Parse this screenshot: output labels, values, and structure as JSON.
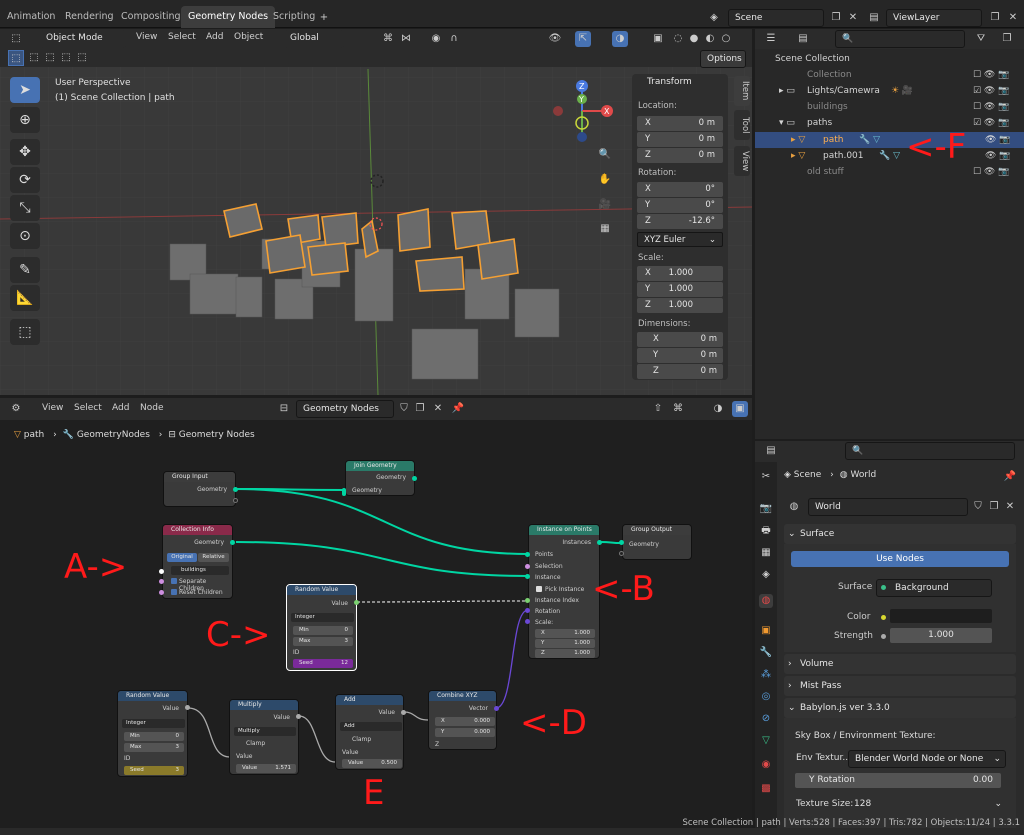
{
  "workspace_tabs": [
    "Animation",
    "Rendering",
    "Compositing",
    "Geometry Nodes",
    "Scripting"
  ],
  "active_tab": "Geometry Nodes",
  "scene_name": "Scene",
  "view_layer": "ViewLayer",
  "viewport": {
    "mode": "Object Mode",
    "menu": [
      "View",
      "Select",
      "Add",
      "Object"
    ],
    "orientation": "Global",
    "options": "Options",
    "perspective": "User Perspective",
    "collection_path": "(1) Scene Collection | path"
  },
  "transform": {
    "title": "Transform",
    "location_label": "Location:",
    "location": [
      {
        "axis": "X",
        "value": "0 m"
      },
      {
        "axis": "Y",
        "value": "0 m"
      },
      {
        "axis": "Z",
        "value": "0 m"
      }
    ],
    "rotation_label": "Rotation:",
    "rotation": [
      {
        "axis": "X",
        "value": "0°"
      },
      {
        "axis": "Y",
        "value": "0°"
      },
      {
        "axis": "Z",
        "value": "-12.6°"
      }
    ],
    "rotation_mode": "XYZ Euler",
    "scale_label": "Scale:",
    "scale": [
      {
        "axis": "X",
        "value": "1.000"
      },
      {
        "axis": "Y",
        "value": "1.000"
      },
      {
        "axis": "Z",
        "value": "1.000"
      }
    ],
    "dimensions_label": "Dimensions:",
    "dimensions": [
      {
        "axis": "X",
        "value": "0 m"
      },
      {
        "axis": "Y",
        "value": "0 m"
      },
      {
        "axis": "Z",
        "value": "0 m"
      }
    ]
  },
  "side_tabs": [
    "Item",
    "Tool",
    "View"
  ],
  "outliner": {
    "rows": [
      {
        "label": "Scene Collection",
        "dim": false,
        "sel": false
      },
      {
        "label": "Collection",
        "dim": true,
        "sel": false
      },
      {
        "label": "Lights/Camewra",
        "dim": false,
        "sel": false
      },
      {
        "label": "buildings",
        "dim": true,
        "sel": false
      },
      {
        "label": "paths",
        "dim": false,
        "sel": false
      },
      {
        "label": "path",
        "dim": false,
        "sel": true
      },
      {
        "label": "path.001",
        "dim": false,
        "sel": false
      },
      {
        "label": "old stuff",
        "dim": true,
        "sel": false
      }
    ]
  },
  "node_editor": {
    "menu": [
      "View",
      "Select",
      "Add",
      "Node"
    ],
    "tree_name": "Geometry Nodes",
    "breadcrumb": [
      "path",
      "GeometryNodes",
      "Geometry Nodes"
    ]
  },
  "nodes": {
    "group_input": {
      "title": "Group Input",
      "out": "Geometry"
    },
    "join_geometry": {
      "title": "Join Geometry",
      "out": "Geometry",
      "in": "Geometry"
    },
    "collection_info": {
      "title": "Collection Info",
      "out": "Geometry",
      "original": "Original",
      "relative": "Relative",
      "collection": "buildings",
      "separate": "Separate Children",
      "reset": "Reset Children"
    },
    "instance_on_points": {
      "title": "Instance on Points",
      "out": "Instances",
      "points": "Points",
      "selection": "Selection",
      "instance": "Instance",
      "pick": "Pick Instance",
      "index": "Instance Index",
      "rotation": "Rotation",
      "scale": "Scale:",
      "sx": "1.000",
      "sy": "1.000",
      "sz": "1.000"
    },
    "group_output": {
      "title": "Group Output",
      "in": "Geometry"
    },
    "random_value_1": {
      "title": "Random Value",
      "out": "Value",
      "type": "Integer",
      "min": "0",
      "max": "3",
      "id": "ID",
      "seed": "12"
    },
    "random_value_2": {
      "title": "Random Value",
      "out": "Value",
      "type": "Integer",
      "min": "0",
      "max": "3",
      "id": "ID",
      "seed": "3"
    },
    "multiply": {
      "title": "Multiply",
      "out": "Value",
      "op": "Multiply",
      "clamp": "Clamp",
      "value": "Value",
      "v2": "1.571"
    },
    "add": {
      "title": "Add",
      "out": "Value",
      "op": "Add",
      "clamp": "Clamp",
      "value": "Value",
      "v2": "0.500"
    },
    "combine_xyz": {
      "title": "Combine XYZ",
      "out": "Vector",
      "x": "0.000",
      "y": "0.000",
      "z": "Z"
    }
  },
  "annotations": {
    "a": "A->",
    "b": "<-B",
    "c": "C->",
    "d": "<-D",
    "e": "E",
    "f": "<-F"
  },
  "properties": {
    "breadcrumb_scene": "Scene",
    "breadcrumb_world": "World",
    "world_name": "World",
    "surface_section": "Surface",
    "use_nodes": "Use Nodes",
    "surface_label": "Surface",
    "surface_value": "Background",
    "color_label": "Color",
    "strength_label": "Strength",
    "strength_value": "1.000",
    "volume": "Volume",
    "mist": "Mist Pass",
    "babylon": "Babylon.js ver 3.3.0",
    "skybox_label": "Sky Box / Environment Texture:",
    "env_label": "Env Textur...",
    "env_value": "Blender World Node or None",
    "yrot_label": "Y Rotation",
    "yrot_value": "0.00",
    "texsize_label": "Texture Size:",
    "texsize_value": "128"
  },
  "status": "Scene Collection | path | Verts:528 | Faces:397 | Tris:782 | Objects:11/24 | 3.3.1"
}
